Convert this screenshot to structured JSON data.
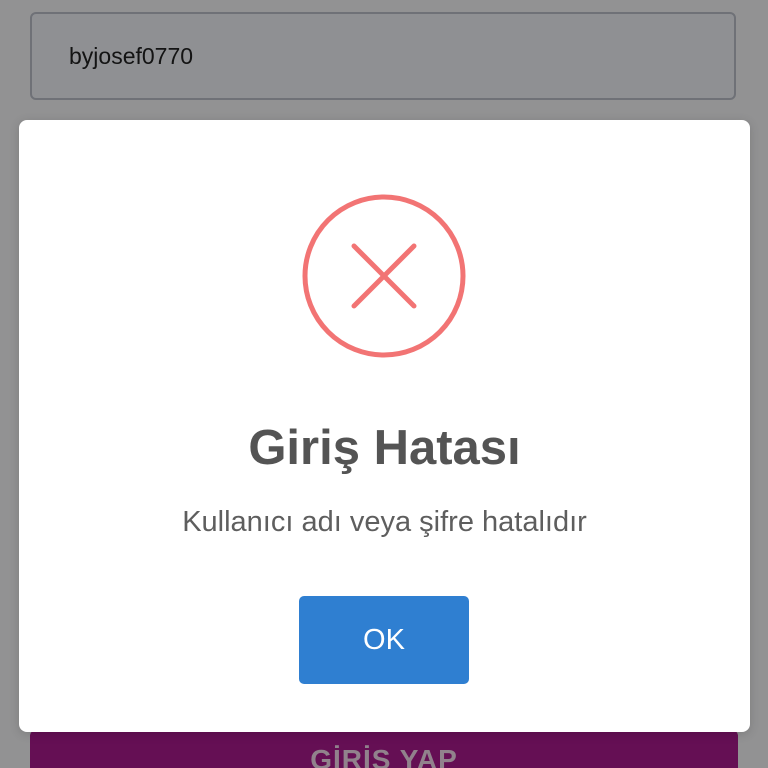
{
  "login_form": {
    "username_value": "byjosef0770",
    "submit_label": "GİRİŞ YAP"
  },
  "dialog": {
    "icon": "error-x-icon",
    "title": "Giriş Hatası",
    "message": "Kullanıcı adı veya şifre hatalıdır",
    "ok_label": "OK"
  },
  "colors": {
    "error_icon": "#f27474",
    "ok_button": "#2f7fd1",
    "submit_button": "#a8198c",
    "title_text": "#545454"
  }
}
